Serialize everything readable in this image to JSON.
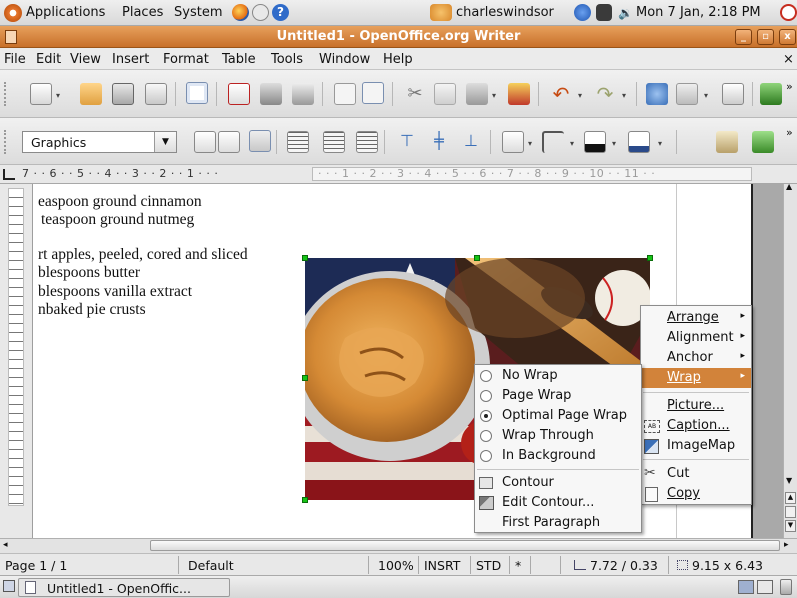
{
  "panel": {
    "menus": [
      "Applications",
      "Places",
      "System"
    ],
    "user": "charleswindsor",
    "clock": "Mon 7 Jan, 2:18 PM"
  },
  "window": {
    "title": "Untitled1 - OpenOffice.org Writer"
  },
  "menubar": [
    "File",
    "Edit",
    "View",
    "Insert",
    "Format",
    "Table",
    "Tools",
    "Window",
    "Help"
  ],
  "style_box": {
    "value": "Graphics"
  },
  "ruler": {
    "text_left": "7 · · 6 · · 5 · · 4 · · 3 · · 2 · · 1 · · ·",
    "text_right": "· · · 1 · · 2 · · 3 · · 4 · · 5 · · 6 · · 7 · · 8 · · 9 · · 10 · · 11 · ·"
  },
  "document": {
    "lines": [
      "easpoon ground cinnamon",
      "teaspoon ground nutmeg",
      "",
      "rt apples, peeled, cored and sliced",
      "blespoons butter",
      "blespoons vanilla extract",
      "nbaked pie crusts"
    ]
  },
  "context_menu": {
    "items": [
      {
        "label": "Arrange",
        "submenu": true
      },
      {
        "label": "Alignment",
        "submenu": true
      },
      {
        "label": "Anchor",
        "submenu": true
      },
      {
        "label": "Wrap",
        "submenu": true,
        "highlighted": true
      },
      {
        "label": "Picture..."
      },
      {
        "label": "Caption..."
      },
      {
        "label": "ImageMap"
      },
      {
        "label": "Cut"
      },
      {
        "label": "Copy"
      }
    ]
  },
  "wrap_menu": {
    "items": [
      {
        "label": "No Wrap",
        "selected": false
      },
      {
        "label": "Page Wrap",
        "selected": false
      },
      {
        "label": "Optimal Page Wrap",
        "selected": true
      },
      {
        "label": "Wrap Through",
        "selected": false
      },
      {
        "label": "In Background",
        "selected": false
      },
      {
        "label": "Contour"
      },
      {
        "label": "Edit Contour..."
      },
      {
        "label": "First Paragraph"
      }
    ]
  },
  "statusbar": {
    "page": "Page 1 / 1",
    "style": "Default",
    "zoom": "100%",
    "insert_mode": "INSRT",
    "selection_mode": "STD",
    "modified": "*",
    "position": "7.72 / 0.33",
    "size": "9.15 x 6.43"
  },
  "taskbar": {
    "task_label": "Untitled1 - OpenOffic..."
  },
  "colors": {
    "accent": "#d47a2f",
    "menu_highlight": "#d2833a",
    "handle": "#16c316"
  }
}
